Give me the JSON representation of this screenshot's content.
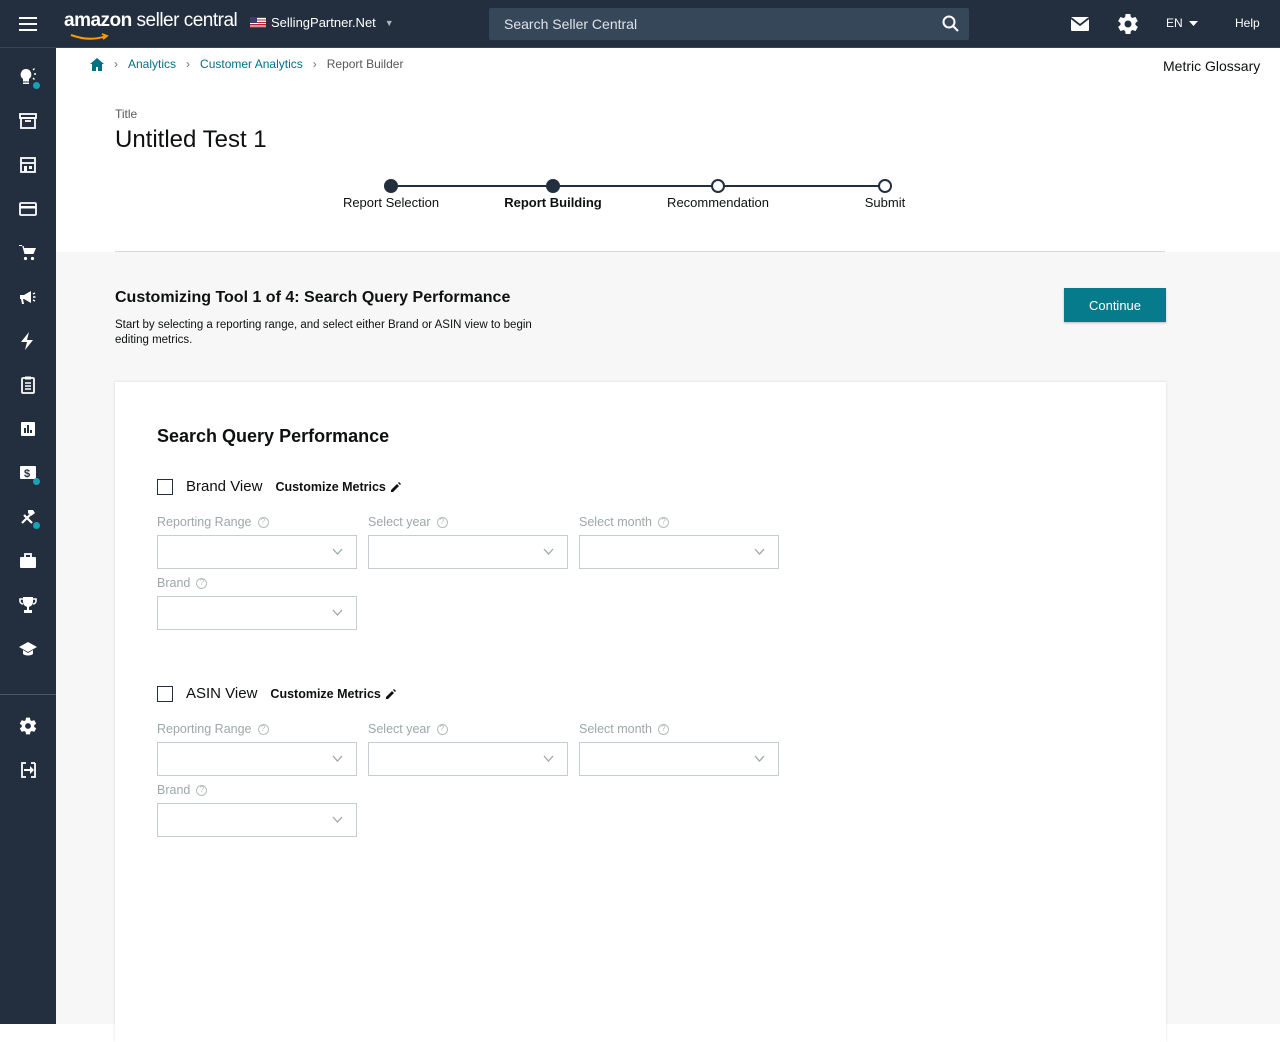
{
  "header": {
    "logo_bold": "amazon",
    "logo_light": " seller central",
    "marketplace": "SellingPartner.Net",
    "search_placeholder": "Search Seller Central",
    "language": "EN",
    "help": "Help"
  },
  "sidenav": {
    "items": [
      "lightbulb-icon",
      "archive-icon",
      "storefront-icon",
      "credit-card-icon",
      "cart-icon",
      "megaphone-icon",
      "lightning-icon",
      "clipboard-icon",
      "bar-chart-icon",
      "dollar-icon",
      "tools-icon",
      "briefcase-icon",
      "trophy-icon",
      "graduation-cap-icon",
      "settings-icon",
      "sign-in-icon"
    ]
  },
  "breadcrumb": {
    "items": [
      "Analytics",
      "Customer Analytics"
    ],
    "current": "Report Builder"
  },
  "metric_glossary": "Metric Glossary",
  "title": {
    "label": "Title",
    "value": "Untitled Test 1"
  },
  "stepper": {
    "steps": [
      {
        "label": "Report Selection",
        "state": "done"
      },
      {
        "label": "Report Building",
        "state": "active"
      },
      {
        "label": "Recommendation",
        "state": "pending"
      },
      {
        "label": "Submit",
        "state": "pending"
      }
    ]
  },
  "section": {
    "title": "Customizing Tool 1 of 4: Search Query Performance",
    "description": "Start by selecting a reporting range, and select either Brand or ASIN view to begin editing metrics.",
    "continue": "Continue"
  },
  "card": {
    "title": "Search Query Performance",
    "brand_view": {
      "label": "Brand View",
      "customize": "Customize Metrics",
      "reporting_range": "Reporting Range",
      "select_year": "Select year",
      "select_month": "Select month",
      "brand": "Brand"
    },
    "asin_view": {
      "label": "ASIN View",
      "customize": "Customize Metrics",
      "reporting_range": "Reporting Range",
      "select_year": "Select year",
      "select_month": "Select month",
      "brand": "Brand"
    }
  },
  "colors": {
    "topbar": "#232f3e",
    "accent_teal": "#057b8c",
    "link": "#007185",
    "nav_dot": "#17a2b8"
  }
}
